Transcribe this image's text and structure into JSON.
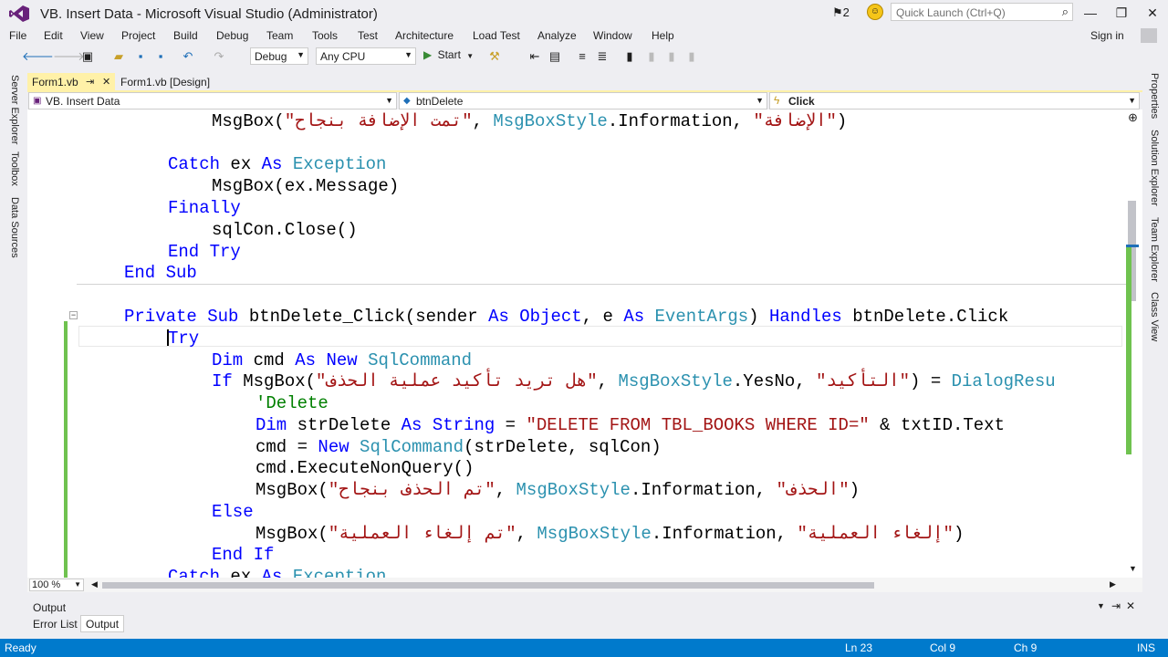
{
  "window": {
    "title": "VB. Insert Data - Microsoft Visual Studio (Administrator)",
    "notifications": "2",
    "quick_launch_placeholder": "Quick Launch (Ctrl+Q)",
    "minimize": "—",
    "restore": "❐",
    "close": "✕"
  },
  "menu": [
    "File",
    "Edit",
    "View",
    "Project",
    "Build",
    "Debug",
    "Team",
    "Tools",
    "Test",
    "Architecture",
    "Load Test",
    "Analyze",
    "Window",
    "Help"
  ],
  "sign_in": "Sign in",
  "toolbar": {
    "config": "Debug",
    "platform": "Any CPU",
    "start": "Start"
  },
  "left_rail": [
    "Server Explorer",
    "Toolbox",
    "Data Sources"
  ],
  "right_rail": [
    "Properties",
    "Solution Explorer",
    "Team Explorer",
    "Class View"
  ],
  "tabs": [
    {
      "label": "Form1.vb",
      "pin": "⇥",
      "close": "✕"
    },
    {
      "label": "Form1.vb [Design]"
    }
  ],
  "nav": {
    "project": "VB. Insert Data",
    "object": "btnDelete",
    "event": "Click"
  },
  "code_lines": [
    [
      {
        "c": "tx",
        "t": "MsgBox("
      },
      {
        "c": "st",
        "t": "\"تمت الإضافة بنجاح\""
      },
      {
        "c": "tx",
        "t": ", "
      },
      {
        "c": "ty",
        "t": "MsgBoxStyle"
      },
      {
        "c": "tx",
        "t": ".Information, "
      },
      {
        "c": "st",
        "t": "\"الإضافة\""
      },
      {
        "c": "tx",
        "t": ")"
      }
    ],
    [],
    [
      {
        "c": "kw",
        "t": "Catch"
      },
      {
        "c": "tx",
        "t": " ex "
      },
      {
        "c": "kw",
        "t": "As"
      },
      {
        "c": "tx",
        "t": " "
      },
      {
        "c": "ty",
        "t": "Exception"
      }
    ],
    [
      {
        "c": "tx",
        "t": "MsgBox(ex.Message)"
      }
    ],
    [
      {
        "c": "kw",
        "t": "Finally"
      }
    ],
    [
      {
        "c": "tx",
        "t": "sqlCon.Close()"
      }
    ],
    [
      {
        "c": "kw",
        "t": "End Try"
      }
    ],
    [
      {
        "c": "kw",
        "t": "End Sub"
      }
    ],
    [],
    [
      {
        "c": "kw",
        "t": "Private Sub"
      },
      {
        "c": "tx",
        "t": " btnDelete_Click(sender "
      },
      {
        "c": "kw",
        "t": "As Object"
      },
      {
        "c": "tx",
        "t": ", e "
      },
      {
        "c": "kw",
        "t": "As"
      },
      {
        "c": "tx",
        "t": " "
      },
      {
        "c": "ty",
        "t": "EventArgs"
      },
      {
        "c": "tx",
        "t": ") "
      },
      {
        "c": "kw",
        "t": "Handles"
      },
      {
        "c": "tx",
        "t": " btnDelete.Click"
      }
    ],
    [
      {
        "c": "kw",
        "t": "Try"
      }
    ],
    [
      {
        "c": "kw",
        "t": "Dim"
      },
      {
        "c": "tx",
        "t": " cmd "
      },
      {
        "c": "kw",
        "t": "As New"
      },
      {
        "c": "tx",
        "t": " "
      },
      {
        "c": "ty",
        "t": "SqlCommand"
      }
    ],
    [
      {
        "c": "kw",
        "t": "If"
      },
      {
        "c": "tx",
        "t": " MsgBox("
      },
      {
        "c": "st",
        "t": "\"هل تريد تأكيد عملية الحذف\""
      },
      {
        "c": "tx",
        "t": ", "
      },
      {
        "c": "ty",
        "t": "MsgBoxStyle"
      },
      {
        "c": "tx",
        "t": ".YesNo, "
      },
      {
        "c": "st",
        "t": "\"التأكيد\""
      },
      {
        "c": "tx",
        "t": ") = "
      },
      {
        "c": "ty",
        "t": "DialogResu"
      }
    ],
    [
      {
        "c": "cm",
        "t": "'Delete"
      }
    ],
    [
      {
        "c": "kw",
        "t": "Dim"
      },
      {
        "c": "tx",
        "t": " strDelete "
      },
      {
        "c": "kw",
        "t": "As String"
      },
      {
        "c": "tx",
        "t": " = "
      },
      {
        "c": "st",
        "t": "\"DELETE FROM TBL_BOOKS WHERE ID=\""
      },
      {
        "c": "tx",
        "t": " & txtID.Text"
      }
    ],
    [
      {
        "c": "tx",
        "t": "cmd = "
      },
      {
        "c": "kw",
        "t": "New"
      },
      {
        "c": "tx",
        "t": " "
      },
      {
        "c": "ty",
        "t": "SqlCommand"
      },
      {
        "c": "tx",
        "t": "(strDelete, sqlCon)"
      }
    ],
    [
      {
        "c": "tx",
        "t": "cmd.ExecuteNonQuery()"
      }
    ],
    [
      {
        "c": "tx",
        "t": "MsgBox("
      },
      {
        "c": "st",
        "t": "\"تم الحذف بنجاح\""
      },
      {
        "c": "tx",
        "t": ", "
      },
      {
        "c": "ty",
        "t": "MsgBoxStyle"
      },
      {
        "c": "tx",
        "t": ".Information, "
      },
      {
        "c": "st",
        "t": "\"الحذف\""
      },
      {
        "c": "tx",
        "t": ")"
      }
    ],
    [
      {
        "c": "kw",
        "t": "Else"
      }
    ],
    [
      {
        "c": "tx",
        "t": "MsgBox("
      },
      {
        "c": "st",
        "t": "\"تم إلغاء العملية\""
      },
      {
        "c": "tx",
        "t": ", "
      },
      {
        "c": "ty",
        "t": "MsgBoxStyle"
      },
      {
        "c": "tx",
        "t": ".Information, "
      },
      {
        "c": "st",
        "t": "\"إلغاء العملية\""
      },
      {
        "c": "tx",
        "t": ")"
      }
    ],
    [
      {
        "c": "kw",
        "t": "End If"
      }
    ],
    [
      {
        "c": "kw",
        "t": "Catch"
      },
      {
        "c": "tx",
        "t": " ex "
      },
      {
        "c": "kw",
        "t": "As"
      },
      {
        "c": "tx",
        "t": " "
      },
      {
        "c": "ty",
        "t": "Exception"
      }
    ]
  ],
  "zoom": "100 %",
  "output": {
    "title": "Output",
    "tabs": [
      "Error List",
      "Output"
    ]
  },
  "status": {
    "ready": "Ready",
    "ln": "Ln 23",
    "col": "Col 9",
    "ch": "Ch 9",
    "ins": "INS"
  },
  "colors": {
    "accent": "#007acc",
    "keyword": "#0000ff",
    "type": "#2b91af",
    "string": "#a31515",
    "comment": "#008000",
    "active_tab": "#fff1a8"
  }
}
